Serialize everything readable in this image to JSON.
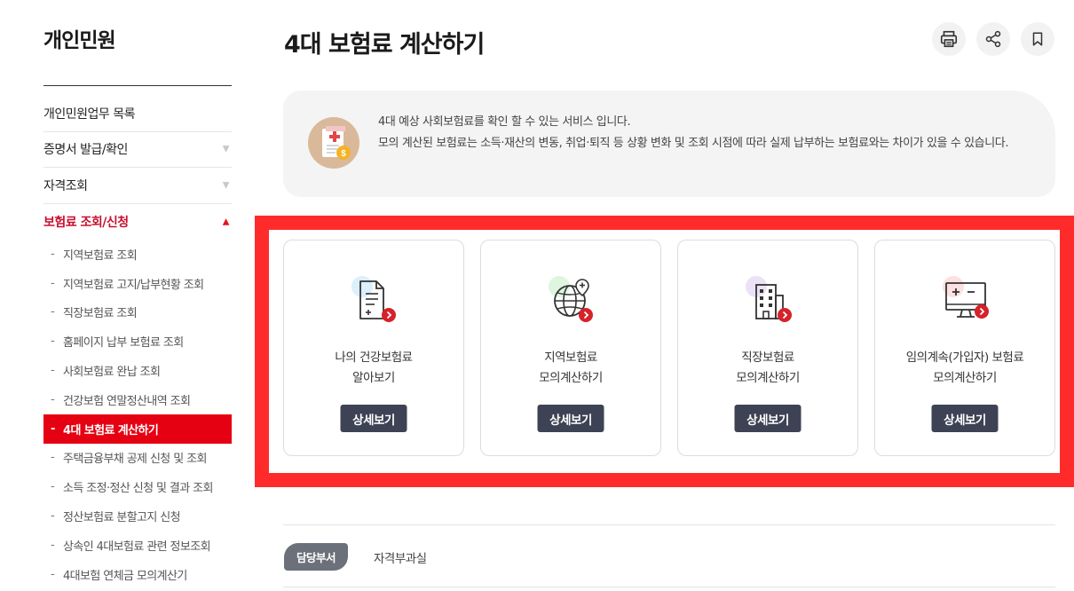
{
  "sidebar": {
    "title": "개인민원",
    "items": [
      {
        "label": "개인민원업무 목록"
      },
      {
        "label": "증명서 발급/확인",
        "arrow": "▼"
      },
      {
        "label": "자격조회",
        "arrow": "▼"
      },
      {
        "label": "보험료 조회/신청",
        "arrow": "▲"
      }
    ],
    "sub_dash": "-",
    "sub_items": [
      {
        "label": "지역보험료 조회"
      },
      {
        "label": "지역보험료 고지/납부현황 조회"
      },
      {
        "label": "직장보험료 조회"
      },
      {
        "label": "홈페이지 납부 보험료 조회"
      },
      {
        "label": "사회보험료 완납 조회"
      },
      {
        "label": "건강보험 연말정산내역 조회"
      },
      {
        "label": "4대 보험료 계산하기"
      },
      {
        "label": "주택금융부채 공제 신청 및 조회"
      },
      {
        "label": "소득 조정·정산 신청 및 결과 조회"
      },
      {
        "label": "정산보험료 분할고지 신청"
      },
      {
        "label": "상속인 4대보험료 관련 정보조회"
      },
      {
        "label": "4대보험 연체금 모의계산기"
      }
    ]
  },
  "page": {
    "title": "4대 보험료 계산하기",
    "tools": [
      {
        "name": "print-icon"
      },
      {
        "name": "share-icon"
      },
      {
        "name": "bookmark-icon"
      }
    ]
  },
  "info": {
    "line1": "4대 예상 사회보험료를 확인 할 수 있는 서비스 입니다.",
    "line2": "모의 계산된 보험료는 소득·재산의 변동, 취업·퇴직 등 상황 변화 및 조회 시점에 따라 실제 납부하는 보험료와는 차이가 있을 수 있습니다.",
    "icon": "insurance-document-icon"
  },
  "cards": [
    {
      "line1": "나의 건강보험료",
      "line2": "알아보기",
      "button": "상세보기",
      "icon": "document-plus-icon",
      "dot_color": "#dceffc"
    },
    {
      "line1": "지역보험료",
      "line2": "모의계산하기",
      "button": "상세보기",
      "icon": "globe-pin-icon",
      "dot_color": "#dff5df"
    },
    {
      "line1": "직장보험료",
      "line2": "모의계산하기",
      "button": "상세보기",
      "icon": "building-icon",
      "dot_color": "#ebe2f7"
    },
    {
      "line1": "임의계속(가입자) 보험료",
      "line2": "모의계산하기",
      "button": "상세보기",
      "icon": "calculator-monitor-icon",
      "dot_color": "#fde0e0"
    }
  ],
  "department": {
    "tab": "담당부서",
    "name": "자격부과실"
  },
  "colors": {
    "accent_red": "#e50012",
    "highlight_red": "#ff2b2b",
    "button_dark": "#3d4354",
    "badge_red": "#d6222a"
  }
}
